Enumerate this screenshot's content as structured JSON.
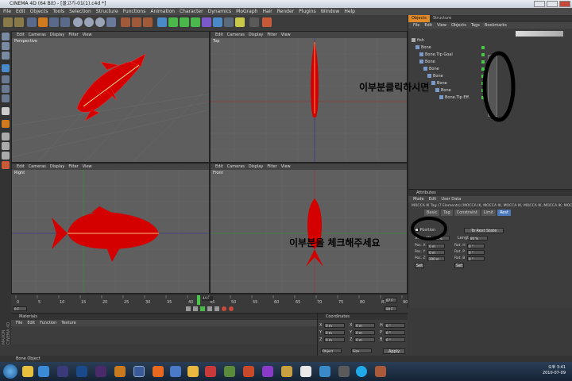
{
  "window": {
    "title": "CINEMA 4D (64 Bit) - [물고기-01(1).c4d *]"
  },
  "menubar": [
    "File",
    "Edit",
    "Objects",
    "Tools",
    "Selection",
    "Structure",
    "Functions",
    "Animation",
    "Character",
    "Dynamics",
    "MoGraph",
    "Hair",
    "Render",
    "Plugins",
    "Window",
    "Help"
  ],
  "viewports": {
    "menu": [
      "Edit",
      "Cameras",
      "Display",
      "Filter",
      "View"
    ],
    "perspective": "Perspective",
    "top": "Top",
    "right": "Right",
    "front": "Front"
  },
  "object_panel": {
    "tabs": [
      "Objects",
      "Structure"
    ],
    "menu": [
      "File",
      "Edit",
      "View",
      "Objects",
      "Tags",
      "Bookmarks"
    ],
    "tree": [
      {
        "label": "fish",
        "indent": 0
      },
      {
        "label": "Bone",
        "indent": 1
      },
      {
        "label": "Bone.Tip Goal",
        "indent": 2
      },
      {
        "label": "Bone",
        "indent": 2
      },
      {
        "label": "Bone",
        "indent": 3
      },
      {
        "label": "Bone",
        "indent": 4
      },
      {
        "label": "Bone",
        "indent": 5
      },
      {
        "label": "Bone",
        "indent": 6
      },
      {
        "label": "Bone.Tip Eff.",
        "indent": 7
      }
    ]
  },
  "attributes": {
    "header": "Attributes",
    "menu": [
      "Mode",
      "Edit",
      "User Data"
    ],
    "tag_title": "MOCCA IK Tag (7 Elements) [MOCCA IK, MOCCA IK, MOCCA IK, MOCCA IK, MOCCA IK, MOCCA IK]",
    "tabs": [
      "Basic",
      "Tag",
      "Constraint",
      "Limit",
      "Rest"
    ],
    "active_tab": "Rest",
    "position_label": "Position",
    "strength_label": "Strength",
    "strength_value": "100 %",
    "set_button": "Set",
    "rest_state_button": "To Rest State",
    "rows": [
      {
        "l1": "Pos. X",
        "v1": "0 m",
        "l2": "Rot. H",
        "v2": "0 °"
      },
      {
        "l1": "Pos. Y",
        "v1": "0 m",
        "l2": "Rot. P",
        "v2": "0 °"
      },
      {
        "l1": "Pos. Z",
        "v1": "200 m",
        "l2": "Rot. B",
        "v2": "0 °"
      }
    ],
    "length_label": "Length",
    "length_value": "80 %"
  },
  "timeline": {
    "ticks": [
      "0",
      "5",
      "10",
      "15",
      "20",
      "25",
      "30",
      "35",
      "40",
      "45",
      "50",
      "55",
      "60",
      "65",
      "70",
      "75",
      "80",
      "85",
      "90"
    ],
    "current_frame": "44 F",
    "start": "0 F",
    "end": "90 F",
    "end2": "87 F"
  },
  "materials": {
    "header": "Materials",
    "menu": [
      "File",
      "Edit",
      "Function",
      "Texture"
    ]
  },
  "coordinates": {
    "header": "Coordinates",
    "rows": [
      {
        "a": "X",
        "av": "0 m",
        "b": "X",
        "bv": "0 m",
        "c": "H",
        "cv": "0 °"
      },
      {
        "a": "Y",
        "av": "0 m",
        "b": "Y",
        "bv": "0 m",
        "c": "P",
        "cv": "0 °"
      },
      {
        "a": "Z",
        "av": "0 m",
        "b": "Z",
        "bv": "0 m",
        "c": "B",
        "cv": "0 °"
      }
    ],
    "mode1": "Object",
    "mode2": "Size",
    "apply": "Apply"
  },
  "status": "Bone Object",
  "side_brand": "MAXON CINEMA 4D",
  "annotations": {
    "upper": "이부분클릭하시면",
    "lower": "이부분을 체크해주세요"
  },
  "taskbar": {
    "time": "오후 3:41",
    "date": "2010-07-09"
  }
}
